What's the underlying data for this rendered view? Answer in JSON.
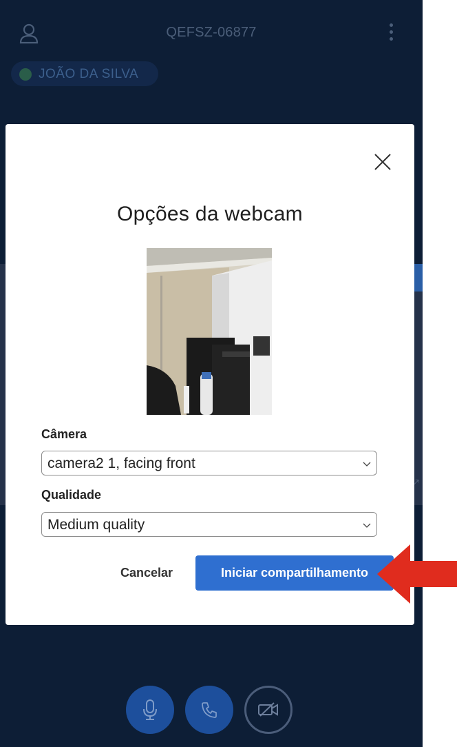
{
  "header": {
    "meeting_code": "QEFSZ-06877",
    "user_icon": "user-icon",
    "menu_icon": "kebab-menu-icon"
  },
  "participant": {
    "name": "JOÃO DA SILVA"
  },
  "modal": {
    "title": "Opções da webcam",
    "close_icon": "close-icon",
    "camera": {
      "label": "Câmera",
      "selected": "camera2 1, facing front"
    },
    "quality": {
      "label": "Qualidade",
      "selected": "Medium quality"
    },
    "cancel_label": "Cancelar",
    "start_label": "Iniciar compartilhamento"
  },
  "controls": {
    "mic_icon": "microphone-icon",
    "phone_icon": "phone-icon",
    "camera_icon": "video-off-icon"
  },
  "colors": {
    "background": "#0d1e36",
    "primary": "#2f6fd0",
    "annotation_arrow": "#e02c1e"
  }
}
